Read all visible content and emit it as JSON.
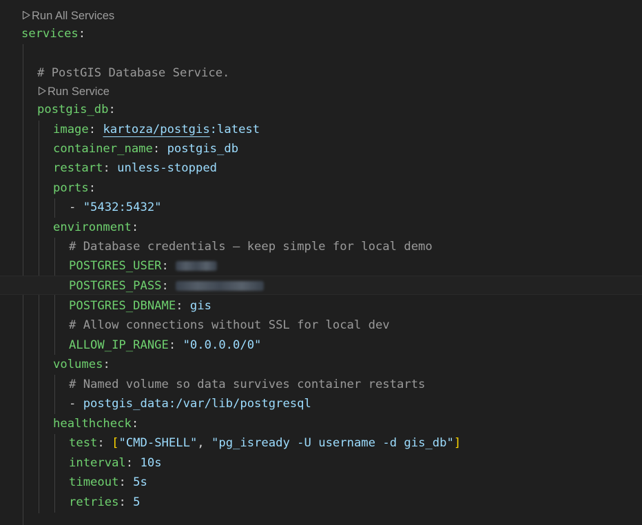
{
  "codelens": {
    "run_all": "Run All Services",
    "run_service": "Run Service"
  },
  "code": {
    "services_key": "services",
    "comment_service": "# PostGIS Database Service.",
    "service_name": "postgis_db",
    "image_key": "image",
    "image_repo": "kartoza/postgis",
    "image_tag": ":latest",
    "container_name_key": "container_name",
    "container_name_val": "postgis_db",
    "restart_key": "restart",
    "restart_val": "unless-stopped",
    "ports_key": "ports",
    "port_item": "\"5432:5432\"",
    "environment_key": "environment",
    "comment_credentials": "# Database credentials — keep simple for local demo",
    "user_key": "POSTGRES_USER",
    "pass_key": "POSTGRES_PASS",
    "dbname_key": "POSTGRES_DBNAME",
    "dbname_val": "gis",
    "comment_ssl": "# Allow connections without SSL for local dev",
    "ip_range_key": "ALLOW_IP_RANGE",
    "ip_range_val": "\"0.0.0.0/0\"",
    "volumes_key": "volumes",
    "comment_volume": "# Named volume so data survives container restarts",
    "volume_item": "postgis_data:/var/lib/postgresql",
    "healthcheck_key": "healthcheck",
    "test_key": "test",
    "test_arg1": "\"CMD-SHELL\"",
    "test_arg2": "\"pg_isready -U username -d gis_db\"",
    "interval_key": "interval",
    "interval_val": "10s",
    "timeout_key": "timeout",
    "timeout_val": "5s",
    "retries_key": "retries",
    "retries_val": "5"
  },
  "colors": {
    "background": "#1f1f1f",
    "key": "#6fd16f",
    "value": "#9cdcfe",
    "comment": "#9a9a9a",
    "bracket": "#ffd700"
  }
}
